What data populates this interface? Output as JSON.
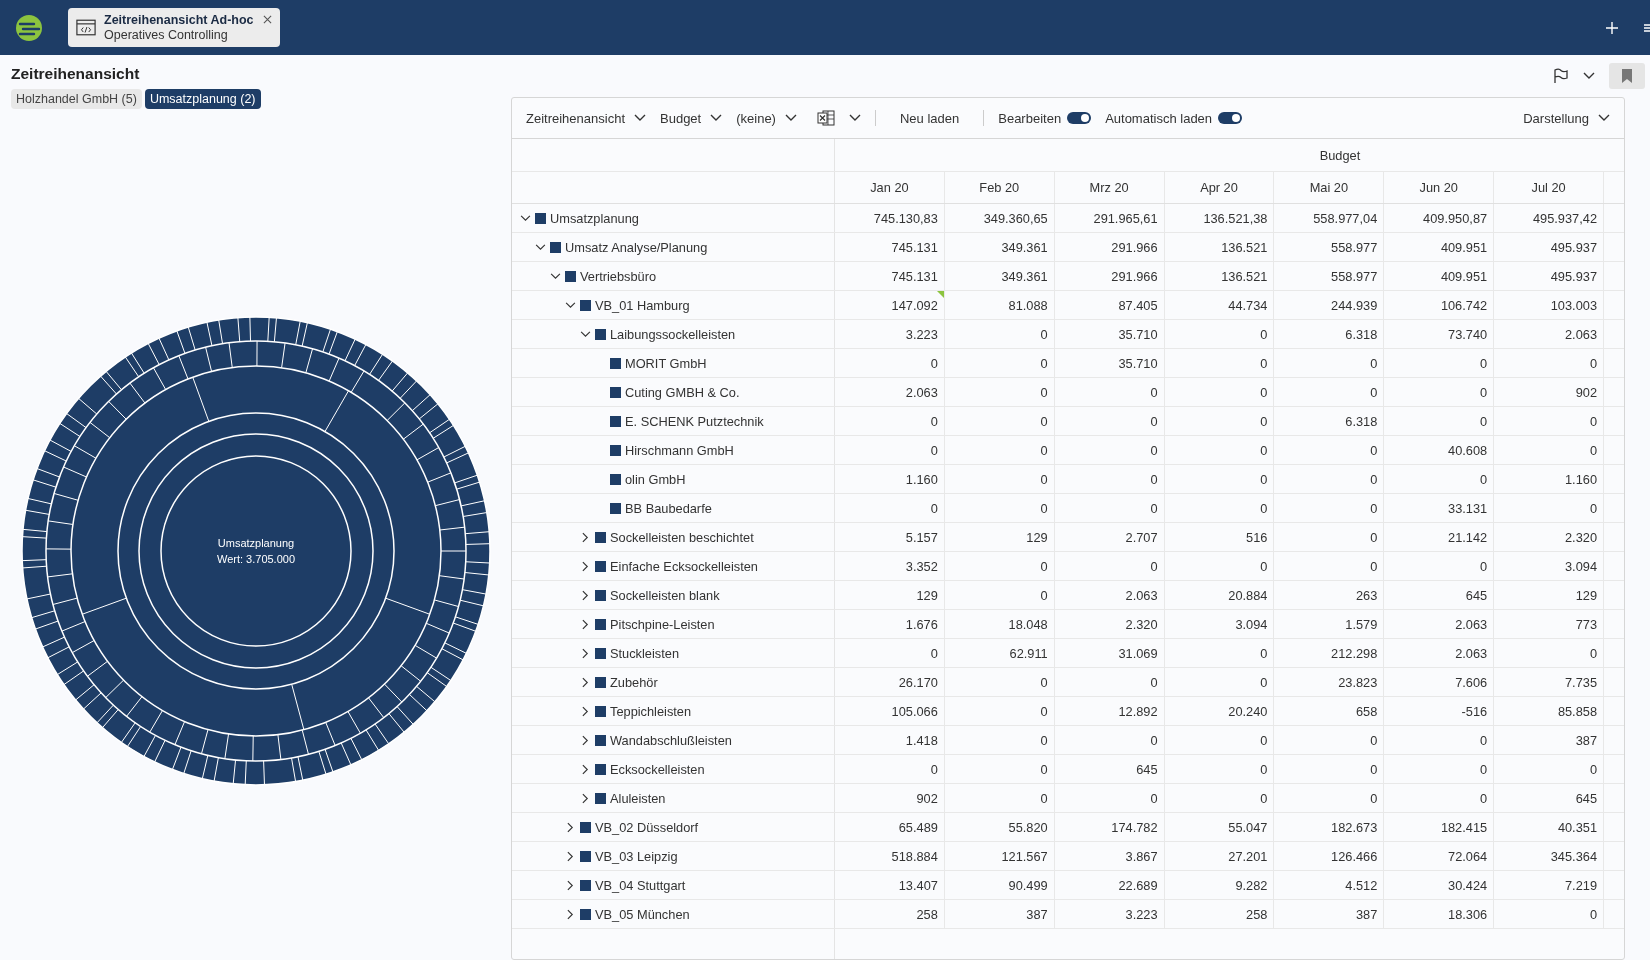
{
  "topbar": {
    "tab": {
      "title": "Zeitreihenansicht Ad-hoc",
      "subtitle": "Operatives Controlling"
    }
  },
  "page": {
    "title": "Zeitreihenansicht",
    "chips": [
      {
        "label": "Holzhandel GmbH (5)",
        "selected": false
      },
      {
        "label": "Umsatzplanung (2)",
        "selected": true
      }
    ]
  },
  "sunburst": {
    "center_label": "Umsatzplanung",
    "center_value": "Wert: 3.705.000"
  },
  "toolbar": {
    "view": "Zeitreihenansicht",
    "version": "Budget",
    "filter": "(keine)",
    "reload": "Neu laden",
    "toggles": [
      {
        "label": "Bearbeiten",
        "on": true
      },
      {
        "label": "Automatisch laden",
        "on": true
      }
    ],
    "display": "Darstellung"
  },
  "table": {
    "group_header": "Budget",
    "columns": [
      "Jan 20",
      "Feb 20",
      "Mrz 20",
      "Apr 20",
      "Mai 20",
      "Jun 20",
      "Jul 20"
    ],
    "rows": [
      {
        "label": "Umsatzplanung",
        "expanded": true,
        "values": [
          "745.130,83",
          "349.360,65",
          "291.965,61",
          "136.521,38",
          "558.977,04",
          "409.950,87",
          "495.937,42"
        ],
        "children": [
          {
            "label": "Umsatz Analyse/Planung",
            "expanded": true,
            "values": [
              "745.131",
              "349.361",
              "291.966",
              "136.521",
              "558.977",
              "409.951",
              "495.937"
            ],
            "children": [
              {
                "label": "Vertriebsbüro",
                "expanded": true,
                "values": [
                  "745.131",
                  "349.361",
                  "291.966",
                  "136.521",
                  "558.977",
                  "409.951",
                  "495.937"
                ],
                "children": [
                  {
                    "label": "VB_01 Hamburg",
                    "expanded": true,
                    "values": [
                      "147.092",
                      "81.088",
                      "87.405",
                      "44.734",
                      "244.939",
                      "106.742",
                      "103.003"
                    ],
                    "marked": [
                      true,
                      false,
                      false,
                      false,
                      false,
                      false,
                      false
                    ],
                    "children": [
                      {
                        "label": "Laibungssockelleisten",
                        "expanded": true,
                        "values": [
                          "3.223",
                          "0",
                          "35.710",
                          "0",
                          "6.318",
                          "73.740",
                          "2.063"
                        ],
                        "children": [
                          {
                            "label": "MORIT GmbH",
                            "values": [
                              "0",
                              "0",
                              "35.710",
                              "0",
                              "0",
                              "0",
                              "0"
                            ]
                          },
                          {
                            "label": "Cuting GMBH & Co.",
                            "values": [
                              "2.063",
                              "0",
                              "0",
                              "0",
                              "0",
                              "0",
                              "902"
                            ]
                          },
                          {
                            "label": "E. SCHENK Putztechnik",
                            "values": [
                              "0",
                              "0",
                              "0",
                              "0",
                              "6.318",
                              "0",
                              "0"
                            ]
                          },
                          {
                            "label": "Hirschmann GmbH",
                            "values": [
                              "0",
                              "0",
                              "0",
                              "0",
                              "0",
                              "40.608",
                              "0"
                            ]
                          },
                          {
                            "label": "olin GmbH",
                            "values": [
                              "1.160",
                              "0",
                              "0",
                              "0",
                              "0",
                              "0",
                              "1.160"
                            ]
                          },
                          {
                            "label": "BB Baubedarfe",
                            "values": [
                              "0",
                              "0",
                              "0",
                              "0",
                              "0",
                              "33.131",
                              "0"
                            ]
                          }
                        ]
                      },
                      {
                        "label": "Sockelleisten beschichtet",
                        "expanded": false,
                        "values": [
                          "5.157",
                          "129",
                          "2.707",
                          "516",
                          "0",
                          "21.142",
                          "2.320"
                        ]
                      },
                      {
                        "label": "Einfache Ecksockelleisten",
                        "expanded": false,
                        "values": [
                          "3.352",
                          "0",
                          "0",
                          "0",
                          "0",
                          "0",
                          "3.094"
                        ]
                      },
                      {
                        "label": "Sockelleisten blank",
                        "expanded": false,
                        "values": [
                          "129",
                          "0",
                          "2.063",
                          "20.884",
                          "263",
                          "645",
                          "129"
                        ]
                      },
                      {
                        "label": "Pitschpine-Leisten",
                        "expanded": false,
                        "values": [
                          "1.676",
                          "18.048",
                          "2.320",
                          "3.094",
                          "1.579",
                          "2.063",
                          "773"
                        ]
                      },
                      {
                        "label": "Stuckleisten",
                        "expanded": false,
                        "values": [
                          "0",
                          "62.911",
                          "31.069",
                          "0",
                          "212.298",
                          "2.063",
                          "0"
                        ]
                      },
                      {
                        "label": "Zubehör",
                        "expanded": false,
                        "values": [
                          "26.170",
                          "0",
                          "0",
                          "0",
                          "23.823",
                          "7.606",
                          "7.735"
                        ]
                      },
                      {
                        "label": "Teppichleisten",
                        "expanded": false,
                        "values": [
                          "105.066",
                          "0",
                          "12.892",
                          "20.240",
                          "658",
                          "-516",
                          "85.858"
                        ]
                      },
                      {
                        "label": "Wandabschlußleisten",
                        "expanded": false,
                        "values": [
                          "1.418",
                          "0",
                          "0",
                          "0",
                          "0",
                          "0",
                          "387"
                        ]
                      },
                      {
                        "label": "Ecksockelleisten",
                        "expanded": false,
                        "values": [
                          "0",
                          "0",
                          "645",
                          "0",
                          "0",
                          "0",
                          "0"
                        ]
                      },
                      {
                        "label": "Aluleisten",
                        "expanded": false,
                        "values": [
                          "902",
                          "0",
                          "0",
                          "0",
                          "0",
                          "0",
                          "645"
                        ]
                      }
                    ]
                  },
                  {
                    "label": "VB_02 Düsseldorf",
                    "expanded": false,
                    "values": [
                      "65.489",
                      "55.820",
                      "174.782",
                      "55.047",
                      "182.673",
                      "182.415",
                      "40.351"
                    ]
                  },
                  {
                    "label": "VB_03 Leipzig",
                    "expanded": false,
                    "values": [
                      "518.884",
                      "121.567",
                      "3.867",
                      "27.201",
                      "126.466",
                      "72.064",
                      "345.364"
                    ]
                  },
                  {
                    "label": "VB_04 Stuttgart",
                    "expanded": false,
                    "values": [
                      "13.407",
                      "90.499",
                      "22.689",
                      "9.282",
                      "4.512",
                      "30.424",
                      "7.219"
                    ]
                  },
                  {
                    "label": "VB_05 München",
                    "expanded": false,
                    "values": [
                      "258",
                      "387",
                      "3.223",
                      "258",
                      "387",
                      "18.306",
                      "0"
                    ]
                  }
                ]
              }
            ]
          }
        ]
      }
    ]
  }
}
